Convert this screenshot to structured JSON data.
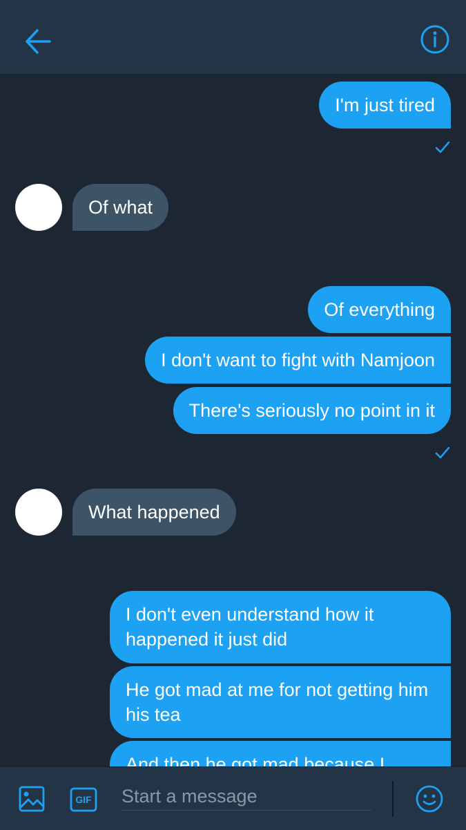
{
  "header": {
    "back_icon": "arrow-left-icon",
    "info_icon": "info-icon",
    "accent_color": "#1da1f2"
  },
  "messages": [
    {
      "direction": "out",
      "text": "I'm just tired"
    },
    {
      "direction": "in",
      "text": "Of what"
    },
    {
      "direction": "out",
      "text": "Of everything"
    },
    {
      "direction": "out",
      "text": "I don't want to fight with Namjoon"
    },
    {
      "direction": "out",
      "text": "There's seriously no point in it"
    },
    {
      "direction": "in",
      "text": "What happened"
    },
    {
      "direction": "out",
      "text": "I don't even understand how it happened it just did"
    },
    {
      "direction": "out",
      "text": "He got mad at me for not getting him his tea"
    },
    {
      "direction": "out",
      "text": "And then he got mad because I"
    }
  ],
  "composer": {
    "image_icon": "image-icon",
    "gif_label": "GIF",
    "placeholder": "Start a message",
    "emoji_icon": "emoji-icon"
  },
  "colors": {
    "background": "#1c2733",
    "bar": "#243447",
    "outgoing_bubble": "#1da1f2",
    "incoming_bubble": "#3d5466"
  }
}
